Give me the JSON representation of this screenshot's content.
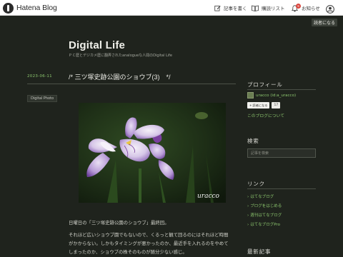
{
  "header": {
    "logo_text": "Hatena Blog",
    "write_label": "記事を書く",
    "reading_label": "購読リスト",
    "notice_label": "お知らせ",
    "notice_count": "9"
  },
  "reader_button": "読者になる",
  "blog": {
    "title": "Digital Life",
    "description": "ＰＣ歴とデジカメ歴に翻弄されたanalogueな人間のDigital Life"
  },
  "entry": {
    "date": "2023-06-11",
    "title": "/* 三ツ塚史跡公園のショウブ(3)　*/",
    "category": "Digital Photo",
    "photo_watermark": "uracco",
    "paragraphs": [
      "日曜日の「三ツ塚史跡公園のショウブ」最終回。",
      "それほど広いショウブ園でもないので、くるっと観て回るのにはそれほど時間",
      "がかからない。しかもタイミングが悪かったのか、最近手を入れるのをやめて",
      "しまったのか、ショウブの株そのものが随分少ない感じ。"
    ]
  },
  "sidebar": {
    "profile_title": "プロフィール",
    "profile_name": "uracco (id:a_uracco)",
    "follow_label": "読者になる",
    "follow_count": "17",
    "about_link": "このブログについて",
    "search_title": "検索",
    "search_placeholder": "記事を検索",
    "links_title": "リンク",
    "links": [
      "はてなブログ",
      "ブログをはじめる",
      "週刊はてなブログ",
      "はてなブログPro"
    ],
    "recent_title": "最新記事"
  },
  "colors": {
    "background": "#1f231d",
    "link": "#8cc66e",
    "date": "#8cc66e"
  }
}
